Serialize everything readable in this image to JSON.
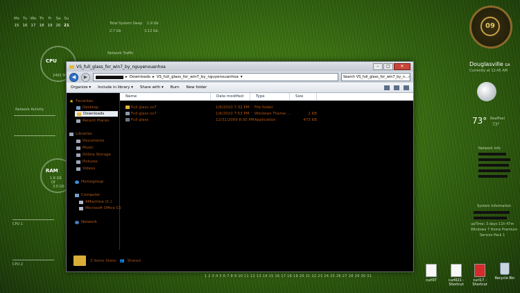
{
  "calendar": {
    "days": [
      "Mo",
      "Tu",
      "We",
      "Th",
      "Fr",
      "Sa",
      "Su"
    ],
    "dates": [
      "15",
      "16",
      "17",
      "18",
      "19",
      "20",
      "21"
    ],
    "today": "21"
  },
  "gadgets": {
    "total_system_swap": "Total System Swap",
    "swap_values": [
      "2.7 Gb",
      "1.9 Gb",
      "3.12 Gb"
    ],
    "network_traffic": "Network Traffic",
    "cpu_label": "CPU",
    "cpu_speed": "2402 Mhz",
    "network_activity": "Network Activity",
    "ram_label": "RAM",
    "ram_used": "1.8 GB",
    "ram_of": "Of",
    "ram_total": "3.0 GB",
    "cpu1": "CPU 1",
    "cpu2": "CPU 2"
  },
  "clock": {
    "value": "09"
  },
  "weather": {
    "city": "Douglasville",
    "state": "GA",
    "currently": "Currently at 12:45 AM",
    "temp": "73°",
    "high": "73°",
    "realfeel": "RealFeel"
  },
  "side_info": {
    "network_info": "Network Info",
    "system_info": "System Information",
    "uptime": "upTime: 3 days 11h 47m",
    "os": "Windows 7 Home Premium",
    "sp": "Service Pack 1"
  },
  "window": {
    "title": "VS_full_glass_for_win7_by_nguyenxuanhoa",
    "address": [
      "Downloads",
      "VS_full_glass_for_win7_by_nguyenxuanhoa"
    ],
    "search_placeholder": "Search VS_full_glass_for_win7_by_n...",
    "toolbar": [
      "Organize ▾",
      "Include in library ▾",
      "Share with ▾",
      "Burn",
      "New folder"
    ],
    "columns": [
      "Name",
      "Date modified",
      "Type",
      "Size"
    ],
    "nav": {
      "favorites": "Favorites",
      "desktop": "Desktop",
      "downloads": "Downloads",
      "recent": "Recent Places",
      "libraries": "Libraries",
      "documents": "Documents",
      "music": "Music",
      "online_storage": "Online Storage",
      "pictures": "Pictures",
      "videos": "Videos",
      "homegroup": "Homegroup",
      "computer": "Computer",
      "drive_c": "AMachine (C:)",
      "drive_office": "Microsoft Office Cli",
      "network": "Network"
    },
    "files": [
      {
        "name": "Full glass vs7",
        "date": "1/6/2010 7:32 PM",
        "type": "File folder",
        "size": ""
      },
      {
        "name": "Full glass vs7",
        "date": "1/6/2010 7:53 PM",
        "type": "Windows Theme ...",
        "size": "2 KB"
      },
      {
        "name": "Full glass",
        "date": "12/31/2009 8:30 PM",
        "type": "Application",
        "size": "473 KB"
      }
    ],
    "status": "3 items  State:",
    "shared": "Shared"
  },
  "taskbar_strip": "1 2 3 4 5 6 7 8 9 10 11 12 13 14 15 16 17 18 19 20 21 22 23 24 25 26 27 28 29 30 31",
  "desktop_icons": [
    {
      "label": "curl07"
    },
    {
      "label": "curl021 - Shortcut"
    },
    {
      "label": "curl17 - Shortcut"
    },
    {
      "label": "Recycle Bin"
    }
  ],
  "colors": {
    "file_text": "#b4560f",
    "window_chrome": "#c9ccd1"
  }
}
